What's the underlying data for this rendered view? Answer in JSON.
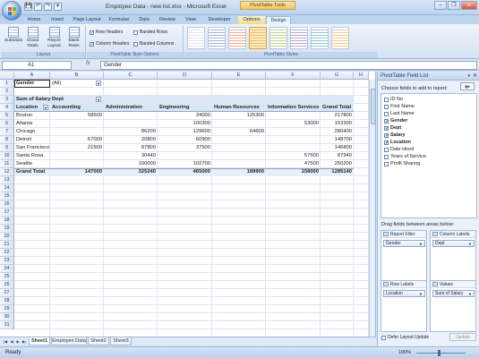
{
  "window": {
    "title": "Employee Data - new list.xlsx - Microsoft Excel",
    "context_title": "PivotTable Tools",
    "controls": [
      "–",
      "❐",
      "✕"
    ]
  },
  "qat": [
    "💾",
    "↶",
    "↷",
    "▾"
  ],
  "tabs": [
    "Home",
    "Insert",
    "Page Layout",
    "Formulas",
    "Data",
    "Review",
    "View",
    "Developer",
    "Options",
    "Design"
  ],
  "ribbon": {
    "layout_group": {
      "label": "Layout",
      "buttons": [
        "Subtotals",
        "Grand Totals",
        "Report Layout",
        "Blank Rows"
      ]
    },
    "style_options_group": {
      "label": "PivotTable Style Options",
      "options": [
        {
          "label": "Row Headers",
          "checked": true,
          "mark": "✓"
        },
        {
          "label": "Banded Rows",
          "checked": false,
          "mark": ""
        },
        {
          "label": "Column Headers",
          "checked": true,
          "mark": "✓"
        },
        {
          "label": "Banded Columns",
          "checked": false,
          "mark": ""
        }
      ]
    },
    "styles_group": {
      "label": "PivotTable Styles"
    }
  },
  "formula_bar": {
    "cell_ref": "A1",
    "fx": "fx",
    "content": "Gender"
  },
  "columns": [
    "A",
    "B",
    "C",
    "D",
    "E",
    "F",
    "G",
    "H"
  ],
  "rows": [
    "1",
    "2",
    "3",
    "4",
    "5",
    "6",
    "7",
    "8",
    "9",
    "10",
    "11",
    "12",
    "13",
    "14",
    "15",
    "16",
    "17",
    "18",
    "19",
    "20",
    "21",
    "22",
    "23",
    "24",
    "25",
    "26",
    "27",
    "28",
    "29",
    "30",
    "31"
  ],
  "pivot": {
    "filter_label": "Gender",
    "filter_value": "(All)",
    "values_label": "Sum of Salary",
    "col_field": "Dept",
    "row_field": "Location",
    "col_headers": [
      "Accounting",
      "Administration",
      "Engineering",
      "Human Resources",
      "Information Services",
      "Grand Total"
    ],
    "rows": [
      {
        "label": "Boston",
        "values": [
          "58500",
          "",
          "34000",
          "125300",
          "",
          "217800"
        ]
      },
      {
        "label": "Atlanta",
        "values": [
          "",
          "",
          "100300",
          "",
          "53000",
          "153300"
        ]
      },
      {
        "label": "Chicago",
        "values": [
          "",
          "86200",
          "129600",
          "64600",
          "",
          "280400"
        ]
      },
      {
        "label": "Detroit",
        "values": [
          "67000",
          "20800",
          "60900",
          "",
          "",
          "148700"
        ]
      },
      {
        "label": "San Francisco",
        "values": [
          "21500",
          "87800",
          "37500",
          "",
          "",
          "146800"
        ]
      },
      {
        "label": "Santa Rosa",
        "values": [
          "",
          "30440",
          "",
          "",
          "57500",
          "87940"
        ]
      },
      {
        "label": "Seattle",
        "values": [
          "",
          "100000",
          "102700",
          "",
          "47500",
          "250200"
        ]
      }
    ],
    "grand_total_label": "Grand Total",
    "grand_total_values": [
      "147000",
      "325240",
      "465000",
      "189900",
      "158000",
      "1285140"
    ]
  },
  "sheets": [
    "Sheet1",
    "Employee Data",
    "Sheet2",
    "Sheet3"
  ],
  "status": {
    "left": "Ready",
    "zoom": "100%"
  },
  "field_list": {
    "title": "PivotTable Field List",
    "choose_label": "Choose fields to add to report:",
    "fields": [
      {
        "name": "ID No",
        "checked": false,
        "mark": ""
      },
      {
        "name": "First Name",
        "checked": false,
        "mark": ""
      },
      {
        "name": "Last Name",
        "checked": false,
        "mark": ""
      },
      {
        "name": "Gender",
        "checked": true,
        "mark": "✓"
      },
      {
        "name": "Dept",
        "checked": true,
        "mark": "✓"
      },
      {
        "name": "Salary",
        "checked": true,
        "mark": "✓"
      },
      {
        "name": "Location",
        "checked": true,
        "mark": "✓"
      },
      {
        "name": "Date Hired",
        "checked": false,
        "mark": ""
      },
      {
        "name": "Years of Service",
        "checked": false,
        "mark": ""
      },
      {
        "name": "Profit Sharing",
        "checked": false,
        "mark": ""
      }
    ],
    "drag_label": "Drag fields between areas below:",
    "areas": [
      {
        "title": "Report Filter",
        "item": "Gender"
      },
      {
        "title": "Column Labels",
        "item": "Dept"
      },
      {
        "title": "Row Labels",
        "item": "Location"
      },
      {
        "title": "Values",
        "item": "Sum of Salary"
      }
    ],
    "defer_label": "Defer Layout Update",
    "update_label": "Update"
  }
}
